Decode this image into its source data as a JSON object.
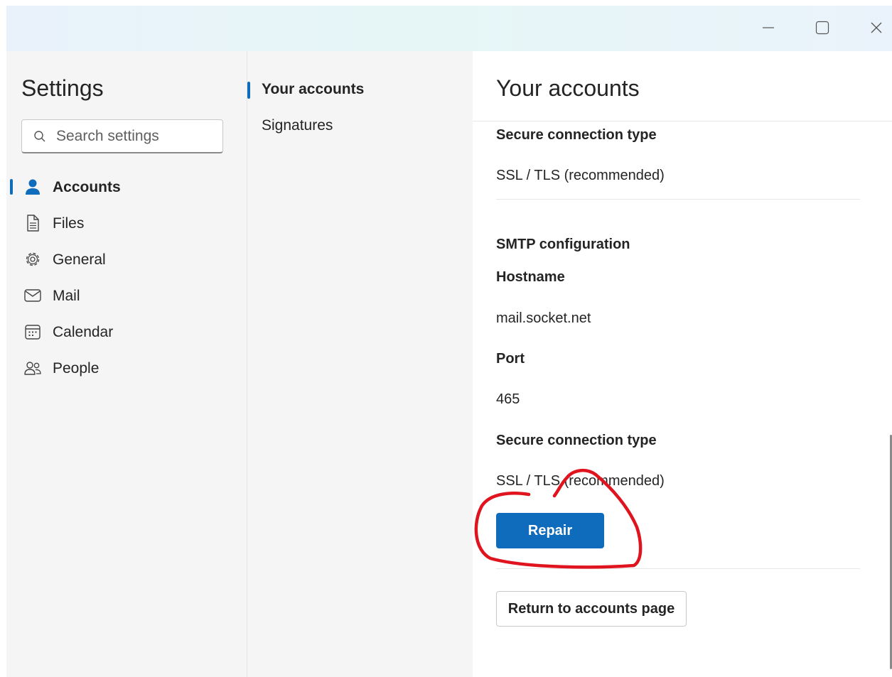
{
  "window": {
    "controls": [
      "minimize",
      "maximize",
      "close"
    ]
  },
  "nav": {
    "title": "Settings",
    "search_placeholder": "Search settings",
    "items": [
      {
        "label": "Accounts",
        "icon": "person-icon",
        "active": true
      },
      {
        "label": "Files",
        "icon": "file-icon",
        "active": false
      },
      {
        "label": "General",
        "icon": "gear-icon",
        "active": false
      },
      {
        "label": "Mail",
        "icon": "mail-icon",
        "active": false
      },
      {
        "label": "Calendar",
        "icon": "calendar-icon",
        "active": false
      },
      {
        "label": "People",
        "icon": "people-icon",
        "active": false
      }
    ]
  },
  "subnav": {
    "items": [
      {
        "label": "Your accounts",
        "active": true
      },
      {
        "label": "Signatures",
        "active": false
      }
    ]
  },
  "panel": {
    "title": "Your accounts",
    "incoming": {
      "secure_label": "Secure connection type",
      "secure_value": "SSL / TLS (recommended)"
    },
    "smtp": {
      "heading": "SMTP configuration",
      "hostname_label": "Hostname",
      "hostname_value": "mail.socket.net",
      "port_label": "Port",
      "port_value": "465",
      "secure_label": "Secure connection type",
      "secure_value": "SSL / TLS (recommended)"
    },
    "repair_button": "Repair",
    "return_button": "Return to accounts page"
  },
  "colors": {
    "accent": "#0f6cbd",
    "annotation": "#e0141e"
  }
}
